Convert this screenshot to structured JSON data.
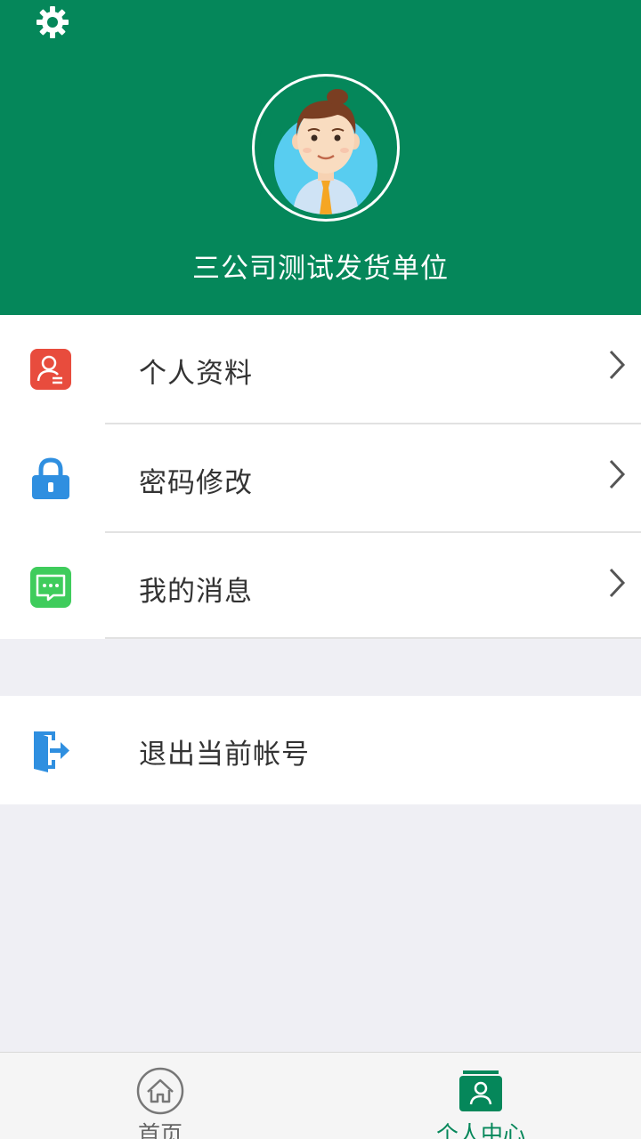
{
  "header": {
    "company_name": "三公司测试发货单位",
    "background_color": "#05875a",
    "settings_icon": "gear-icon",
    "avatar": "user-avatar-illustration"
  },
  "menu": {
    "items": [
      {
        "label": "个人资料",
        "icon": "profile-card-icon",
        "icon_color": "#e84c3d"
      },
      {
        "label": "密码修改",
        "icon": "lock-icon",
        "icon_color": "#2f8fe0"
      },
      {
        "label": "我的消息",
        "icon": "message-icon",
        "icon_color": "#3fcc5c"
      }
    ],
    "logout": {
      "label": "退出当前帐号",
      "icon": "logout-door-icon",
      "icon_color": "#2f8fe0"
    }
  },
  "tabbar": {
    "tabs": [
      {
        "label": "首页",
        "icon": "home-icon",
        "active": false
      },
      {
        "label": "个人中心",
        "icon": "person-card-icon",
        "active": true
      }
    ],
    "active_color": "#05875a"
  }
}
